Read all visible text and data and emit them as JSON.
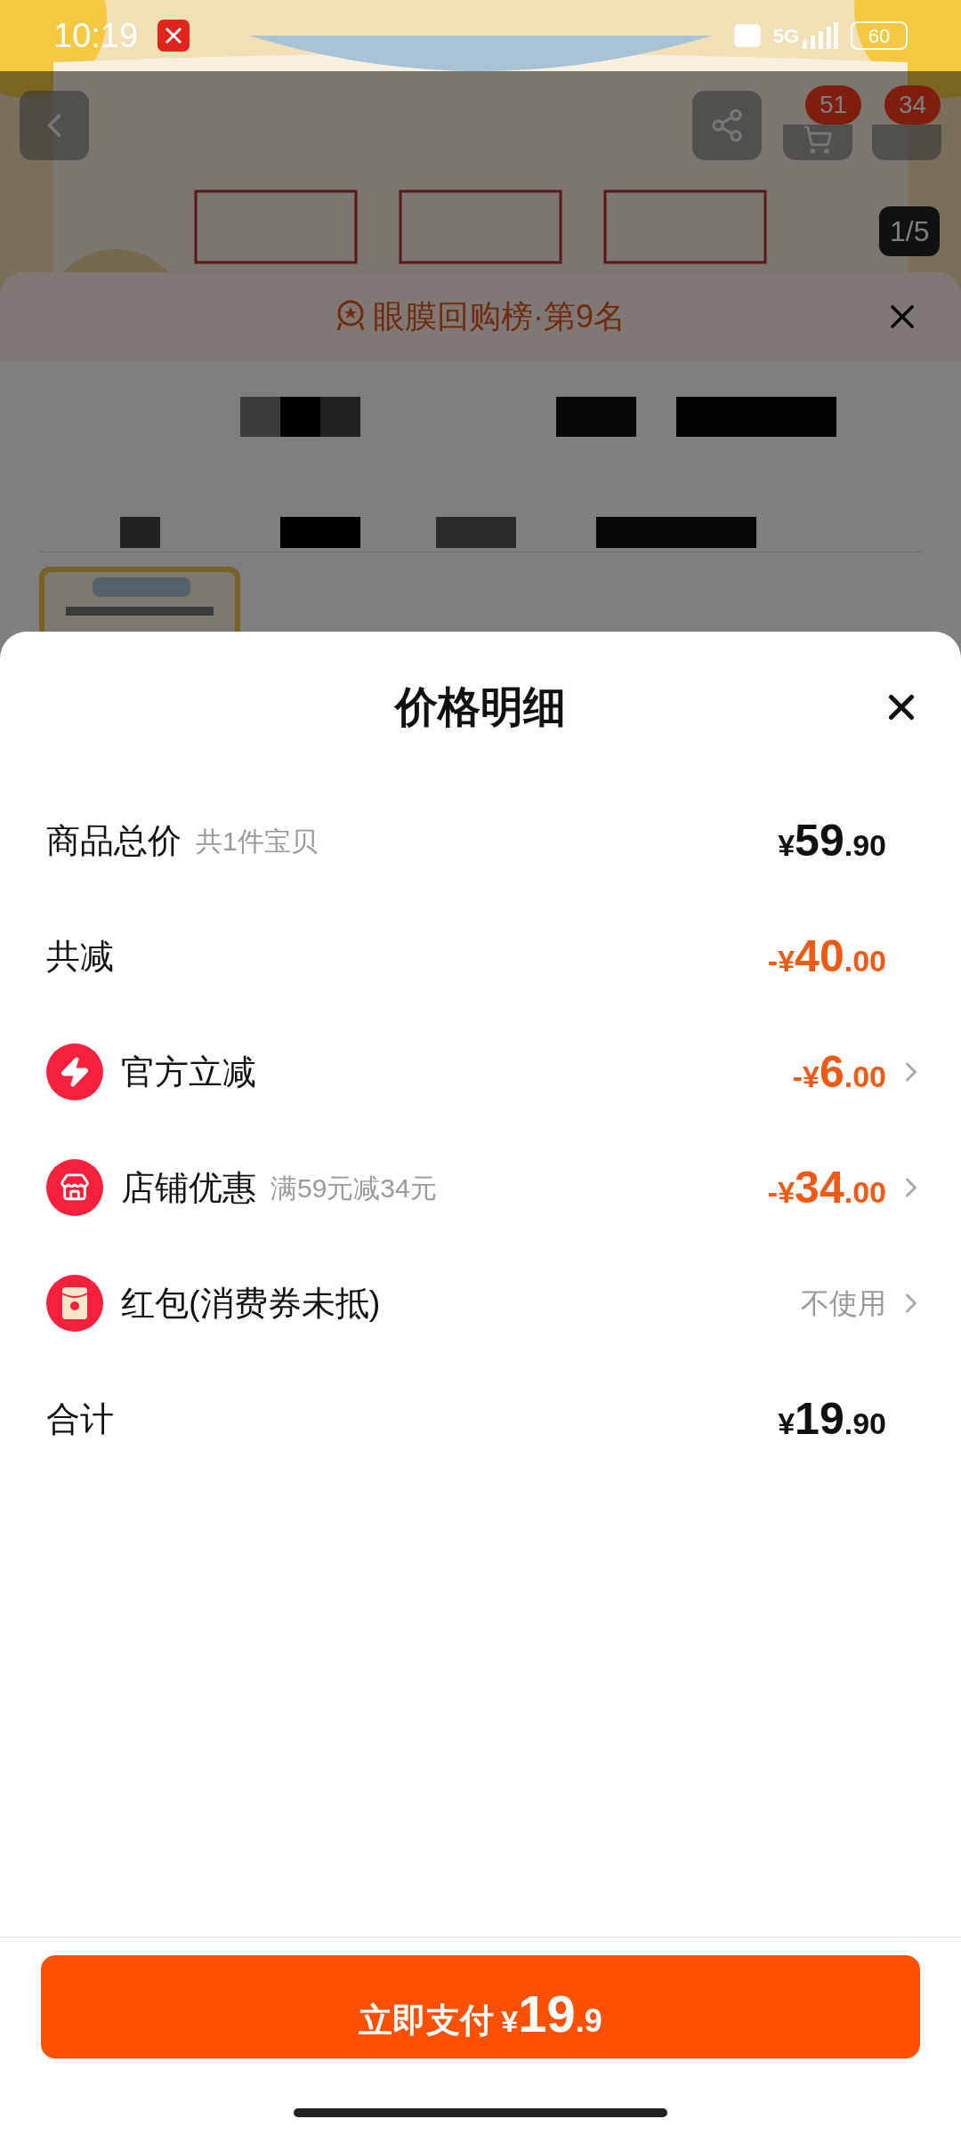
{
  "status_bar": {
    "time": "10:19",
    "network": "5G",
    "battery": "60"
  },
  "product_page": {
    "cart_badge": "51",
    "message_badge": "34",
    "gallery_counter": "1/5"
  },
  "ranking_sheet": {
    "title": "眼膜回购榜·第9名"
  },
  "price_sheet": {
    "title": "价格明细",
    "rows": [
      {
        "kind": "summary",
        "label": "商品总价",
        "note": "共1件宝贝",
        "amount": {
          "currency": "¥",
          "integer": "59",
          "decimal": ".90"
        }
      },
      {
        "kind": "reduction",
        "label": "共减",
        "amount": {
          "sign": "-",
          "currency": "¥",
          "integer": "40",
          "decimal": ".00"
        }
      },
      {
        "kind": "official",
        "label": "官方立减",
        "amount": {
          "sign": "-",
          "currency": "¥",
          "integer": "6",
          "decimal": ".00"
        }
      },
      {
        "kind": "store",
        "label": "店铺优惠",
        "note": "满59元减34元",
        "amount": {
          "sign": "-",
          "currency": "¥",
          "integer": "34",
          "decimal": ".00"
        }
      },
      {
        "kind": "redpacket",
        "label": "红包(消费券未抵)",
        "value": "不使用"
      },
      {
        "kind": "summary",
        "label": "合计",
        "amount": {
          "currency": "¥",
          "integer": "19",
          "decimal": ".90"
        }
      }
    ],
    "pay_button": {
      "label": "立即支付",
      "currency": "¥",
      "integer": "19",
      "decimal": ".9"
    }
  }
}
